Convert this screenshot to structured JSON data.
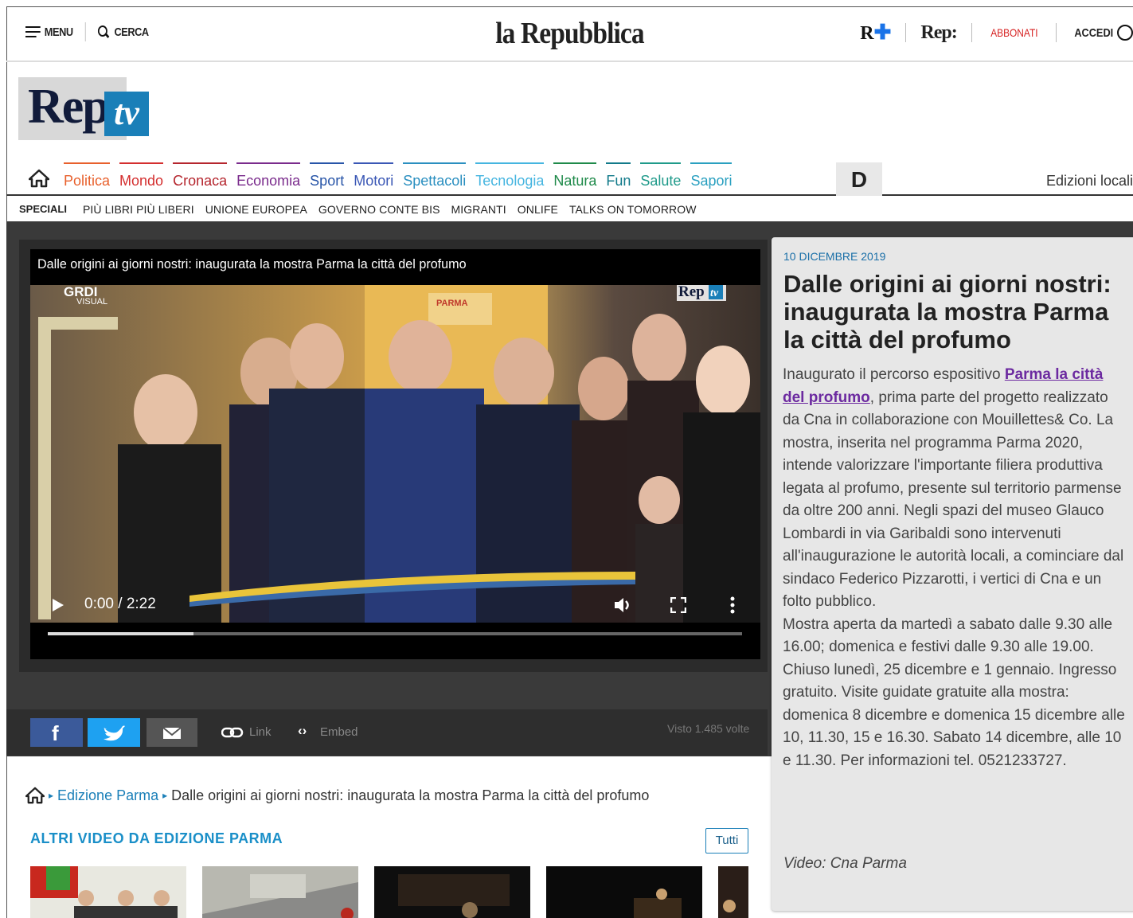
{
  "topbar": {
    "menu_label": "MENU",
    "search_label": "CERCA",
    "logo": "la Repubblica",
    "rplus": "R",
    "rep": "Rep:",
    "abbonati": "ABBONATI",
    "accedi": "ACCEDI"
  },
  "reptv": {
    "rep": "Rep",
    "tv": "tv"
  },
  "sections": [
    {
      "label": "Politica",
      "color": "#e8602c"
    },
    {
      "label": "Mondo",
      "color": "#d42f2f"
    },
    {
      "label": "Cronaca",
      "color": "#b5262e"
    },
    {
      "label": "Economia",
      "color": "#7a2b8c"
    },
    {
      "label": "Sport",
      "color": "#2855a8"
    },
    {
      "label": "Motori",
      "color": "#3a57b5"
    },
    {
      "label": "Spettacoli",
      "color": "#2a8fc0"
    },
    {
      "label": "Tecnologia",
      "color": "#45b5e0"
    },
    {
      "label": "Natura",
      "color": "#1f8a4a"
    },
    {
      "label": "Fun",
      "color": "#127a8a"
    },
    {
      "label": "Salute",
      "color": "#1f9a8a"
    },
    {
      "label": "Sapori",
      "color": "#2aa0c0"
    }
  ],
  "nav": {
    "d_label": "D",
    "edizioni": "Edizioni locali"
  },
  "speciali": {
    "label": "SPECIALI",
    "items": [
      "PIÙ LIBRI PIÙ LIBERI",
      "UNIONE EUROPEA",
      "GOVERNO CONTE BIS",
      "MIGRANTI",
      "ONLIFE",
      "TALKS ON TOMORROW"
    ]
  },
  "video": {
    "title": "Dalle origini ai giorni nostri: inaugurata la mostra Parma la città del profumo",
    "time": "0:00 / 2:22",
    "progress": 0.21,
    "watermark_left": "GRDI",
    "watermark_left_sub": "VISUAL",
    "watermark_right": "Rep",
    "watermark_right_tv": "tv",
    "sign": "PARMA"
  },
  "share": {
    "link": "Link",
    "embed": "Embed",
    "views": "Visto 1.485 volte"
  },
  "article": {
    "date": "10 DICEMBRE 2019",
    "title": "Dalle origini ai giorni nostri: inaugurata la mostra Parma la città del profumo",
    "body_pre": "Inaugurato il percorso espositivo ",
    "body_link": "Parma la città del profumo",
    "body_post": ", prima parte del progetto realizzato da Cna in collaborazione con Mouillettes& Co. La mostra, inserita nel programma Parma 2020, intende valorizzare l'importante filiera produttiva legata al profumo, presente sul territorio parmense da oltre 200 anni. Negli spazi del museo Glauco Lombardi in via Garibaldi sono intervenuti all'inaugurazione le autorità locali, a cominciare dal sindaco Federico Pizzarotti, i vertici di Cna e un folto pubblico.",
    "body_2": "Mostra aperta da martedì a sabato dalle 9.30 alle 16.00; domenica e festivi dalle 9.30 alle 19.00. Chiuso lunedì, 25 dicembre e 1 gennaio. Ingresso gratuito. Visite guidate gratuite alla mostra: domenica 8 dicembre e domenica 15 dicembre alle 10, 11.30, 15 e 16.30. Sabato 14 dicembre, alle 10 e 11.30. Per informazioni tel. 0521233727.",
    "credit": "Video: Cna Parma"
  },
  "breadcrumb": {
    "edition": "Edizione Parma",
    "current": "Dalle origini ai giorni nostri: inaugurata la mostra Parma la città del profumo"
  },
  "altri": {
    "heading": "ALTRI VIDEO DA EDIZIONE PARMA",
    "tutti": "Tutti"
  },
  "colors": {
    "accent": "#1a7fb8",
    "facebook": "#3b5a9a",
    "twitter": "#1ea1f1",
    "abbonati": "#d62020",
    "link": "#6c2aa0"
  }
}
